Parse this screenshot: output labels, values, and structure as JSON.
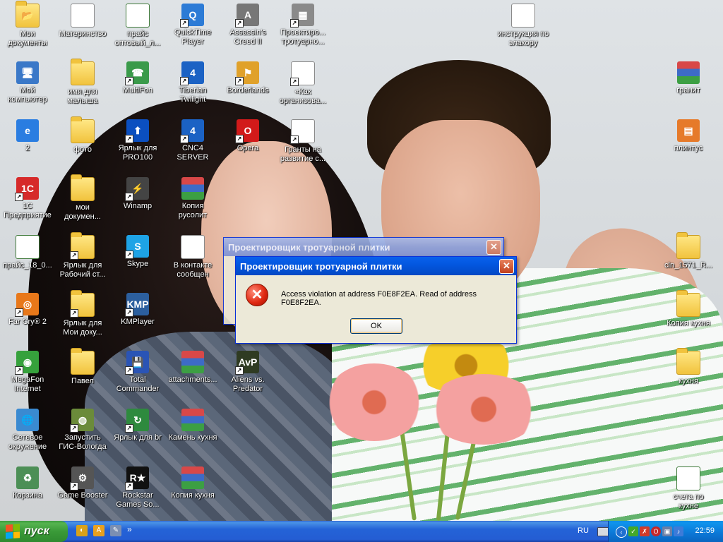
{
  "desktop_icons": [
    {
      "id": "my-docs",
      "label": "Мои\nдокументы",
      "col": 0,
      "row": 0,
      "glyph": "📂",
      "kind": "folder",
      "shortcut": false
    },
    {
      "id": "materinstvo",
      "label": "Материнство",
      "col": 1,
      "row": 0,
      "glyph": "O",
      "kind": "opera-doc",
      "shortcut": false
    },
    {
      "id": "price-opt",
      "label": "прайс\nоптовый_л...",
      "col": 2,
      "row": 0,
      "glyph": "X",
      "kind": "xls",
      "shortcut": false
    },
    {
      "id": "quicktime",
      "label": "QuickTime\nPlayer",
      "col": 3,
      "row": 0,
      "glyph": "Q",
      "kind": "app",
      "color": "#2c7bd6",
      "shortcut": true
    },
    {
      "id": "assassins",
      "label": "Assassin's\nCreed II",
      "col": 4,
      "row": 0,
      "glyph": "A",
      "kind": "app",
      "color": "#777",
      "shortcut": true
    },
    {
      "id": "proekt-1",
      "label": "Проектиро...\nтротуарно...",
      "col": 5,
      "row": 0,
      "glyph": "▦",
      "kind": "app",
      "color": "#8a8a8a",
      "shortcut": true
    },
    {
      "id": "instr",
      "label": "инструкция по\nэлакору",
      "col": 9,
      "row": 0,
      "glyph": "W",
      "kind": "doc",
      "shortcut": false
    },
    {
      "id": "my-comp",
      "label": "Мой\nкомпьютер",
      "col": 0,
      "row": 1,
      "glyph": "🖥",
      "kind": "app",
      "color": "#3a78c8",
      "shortcut": false
    },
    {
      "id": "imya",
      "label": "имя для\nмалыша",
      "col": 1,
      "row": 1,
      "kind": "folder",
      "shortcut": false
    },
    {
      "id": "multifon",
      "label": "MultiFon",
      "col": 2,
      "row": 1,
      "glyph": "☎",
      "kind": "app",
      "color": "#3a9a4a",
      "shortcut": true
    },
    {
      "id": "tiberian",
      "label": "Tiberian\nTwilight",
      "col": 3,
      "row": 1,
      "glyph": "4",
      "kind": "app",
      "color": "#1b62c4",
      "shortcut": true
    },
    {
      "id": "borderlands",
      "label": "Borderlands",
      "col": 4,
      "row": 1,
      "glyph": "⚑",
      "kind": "app",
      "color": "#e0a12a",
      "shortcut": true
    },
    {
      "id": "kak-org",
      "label": "«Как\nорганизова...",
      "col": 5,
      "row": 1,
      "glyph": "O",
      "kind": "opera-doc",
      "shortcut": true
    },
    {
      "id": "granit",
      "label": "гранит",
      "col": 12,
      "row": 1,
      "kind": "rar",
      "shortcut": false
    },
    {
      "id": "ie2",
      "label": "2",
      "col": 0,
      "row": 2,
      "glyph": "e",
      "kind": "app",
      "color": "#2a7de1",
      "shortcut": false
    },
    {
      "id": "foto",
      "label": "фото",
      "col": 1,
      "row": 2,
      "kind": "folder",
      "shortcut": false
    },
    {
      "id": "pro100",
      "label": "Ярлык для\nPRO100",
      "col": 2,
      "row": 2,
      "glyph": "⬆",
      "kind": "app",
      "color": "#0b4fc0",
      "shortcut": true
    },
    {
      "id": "cnc4",
      "label": "CNC4 SERVER",
      "col": 3,
      "row": 2,
      "glyph": "4",
      "kind": "app",
      "color": "#1b62c4",
      "shortcut": true
    },
    {
      "id": "opera",
      "label": "Opera",
      "col": 4,
      "row": 2,
      "glyph": "O",
      "kind": "app",
      "color": "#d21a1a",
      "shortcut": true
    },
    {
      "id": "granty",
      "label": "Гранты на\nразвитие с...",
      "col": 5,
      "row": 2,
      "glyph": "O",
      "kind": "opera-doc",
      "shortcut": true
    },
    {
      "id": "plintus",
      "label": "плинтус",
      "col": 12,
      "row": 2,
      "glyph": "▤",
      "kind": "app",
      "color": "#e67a2a",
      "shortcut": false
    },
    {
      "id": "1c",
      "label": "1С\nПредприятие",
      "col": 0,
      "row": 3,
      "glyph": "1С",
      "kind": "app",
      "color": "#d62a2a",
      "shortcut": true
    },
    {
      "id": "moi-dok",
      "label": "мои\nдокумен...",
      "col": 1,
      "row": 3,
      "kind": "folder",
      "shortcut": false
    },
    {
      "id": "winamp",
      "label": "Winamp",
      "col": 2,
      "row": 3,
      "glyph": "⚡",
      "kind": "app",
      "color": "#444",
      "shortcut": true
    },
    {
      "id": "kopiya-rusolit",
      "label": "Копия\nрусолит",
      "col": 3,
      "row": 3,
      "kind": "rar",
      "shortcut": false
    },
    {
      "id": "price18",
      "label": "прайс_18_0...",
      "col": 0,
      "row": 4,
      "glyph": "X",
      "kind": "xls",
      "shortcut": false
    },
    {
      "id": "rab-st",
      "label": "Ярлык для\nРабочий ст...",
      "col": 1,
      "row": 4,
      "kind": "folder",
      "shortcut": true
    },
    {
      "id": "skype",
      "label": "Skype",
      "col": 2,
      "row": 4,
      "glyph": "S",
      "kind": "app",
      "color": "#1ea3e6",
      "shortcut": true
    },
    {
      "id": "vkontakte",
      "label": "В контакте\nсообщен",
      "col": 3,
      "row": 4,
      "glyph": "W",
      "kind": "doc",
      "shortcut": false
    },
    {
      "id": "cln",
      "label": "cln_1571_R...",
      "col": 12,
      "row": 4,
      "kind": "folder",
      "shortcut": false
    },
    {
      "id": "farcry",
      "label": "Far Cry® 2",
      "col": 0,
      "row": 5,
      "glyph": "◎",
      "kind": "app",
      "color": "#e8781a",
      "shortcut": true
    },
    {
      "id": "moi-doku",
      "label": "Ярлык для\nМои доку...",
      "col": 1,
      "row": 5,
      "kind": "folder",
      "shortcut": true
    },
    {
      "id": "kmplayer",
      "label": "KMPlayer",
      "col": 2,
      "row": 5,
      "glyph": "KMP",
      "kind": "app",
      "color": "#2c5f9e",
      "shortcut": true
    },
    {
      "id": "kopiya-kuhnya",
      "label": "Копия кухня",
      "col": 12,
      "row": 5,
      "kind": "folder",
      "shortcut": false
    },
    {
      "id": "megafon",
      "label": "MegaFon\nInternet",
      "col": 0,
      "row": 6,
      "glyph": "◉",
      "kind": "app",
      "color": "#36a13c",
      "shortcut": true
    },
    {
      "id": "pavel",
      "label": "Павел",
      "col": 1,
      "row": 6,
      "kind": "folder",
      "shortcut": false
    },
    {
      "id": "totalcmd",
      "label": "Total\nCommander",
      "col": 2,
      "row": 6,
      "glyph": "💾",
      "kind": "app",
      "color": "#2a54b5",
      "shortcut": true
    },
    {
      "id": "attachments",
      "label": "attachments...",
      "col": 3,
      "row": 6,
      "kind": "rar",
      "shortcut": false
    },
    {
      "id": "avp",
      "label": "Aliens vs.\nPredator",
      "col": 4,
      "row": 6,
      "glyph": "AvP",
      "kind": "app",
      "color": "#2f3b22",
      "shortcut": true
    },
    {
      "id": "kuhnya",
      "label": "кухня",
      "col": 12,
      "row": 6,
      "kind": "folder",
      "shortcut": false
    },
    {
      "id": "network",
      "label": "Сетевое\nокружение",
      "col": 0,
      "row": 7,
      "glyph": "🌐",
      "kind": "app",
      "color": "#3a8ad1",
      "shortcut": false
    },
    {
      "id": "gis",
      "label": "Запустить\nГИС-Вологда",
      "col": 1,
      "row": 7,
      "glyph": "◍",
      "kind": "app",
      "color": "#6b8b3a",
      "shortcut": true
    },
    {
      "id": "yarlyk-br",
      "label": "Ярлык для br",
      "col": 2,
      "row": 7,
      "glyph": "↻",
      "kind": "app",
      "color": "#2e8a3e",
      "shortcut": true
    },
    {
      "id": "kamen",
      "label": "Камень кухня",
      "col": 3,
      "row": 7,
      "kind": "rar",
      "shortcut": false
    },
    {
      "id": "recycle",
      "label": "Корзина",
      "col": 0,
      "row": 8,
      "glyph": "♻",
      "kind": "app",
      "color": "#4c8f56",
      "shortcut": false
    },
    {
      "id": "gamebooster",
      "label": "Game Booster",
      "col": 1,
      "row": 8,
      "glyph": "⚙",
      "kind": "app",
      "color": "#555",
      "shortcut": true
    },
    {
      "id": "rockstar",
      "label": "Rockstar\nGames So...",
      "col": 2,
      "row": 8,
      "glyph": "R★",
      "kind": "app",
      "color": "#111",
      "shortcut": true
    },
    {
      "id": "kopiya-kuhnya2",
      "label": "Копия кухня",
      "col": 3,
      "row": 8,
      "kind": "rar",
      "shortcut": false
    },
    {
      "id": "scheta",
      "label": "счета по\nкухне",
      "col": 12,
      "row": 8,
      "glyph": "X",
      "kind": "xls",
      "shortcut": false
    }
  ],
  "dialog_back": {
    "title": "Проектировщик тротуарной плитки",
    "close_glyph": "✕"
  },
  "dialog_front": {
    "title": "Проектировщик тротуарной плитки",
    "close_glyph": "✕",
    "error_glyph": "✕",
    "message": "Access violation at address F0E8F2EA. Read of address F0E8F2EA.",
    "ok_label": "OK"
  },
  "taskbar": {
    "start_label": "пуск",
    "quick_launch": [
      {
        "id": "ql-1",
        "glyph": "◐",
        "color": "#d9a21b"
      },
      {
        "id": "ql-2",
        "glyph": "A",
        "color": "#e8a020"
      },
      {
        "id": "ql-3",
        "glyph": "✎",
        "color": "#7b8fb3"
      }
    ],
    "chevron": "»",
    "language": "RU",
    "clock": "22:59"
  },
  "colors": {
    "xp_blue": "#0357e0",
    "start_green": "#3a9a38"
  }
}
